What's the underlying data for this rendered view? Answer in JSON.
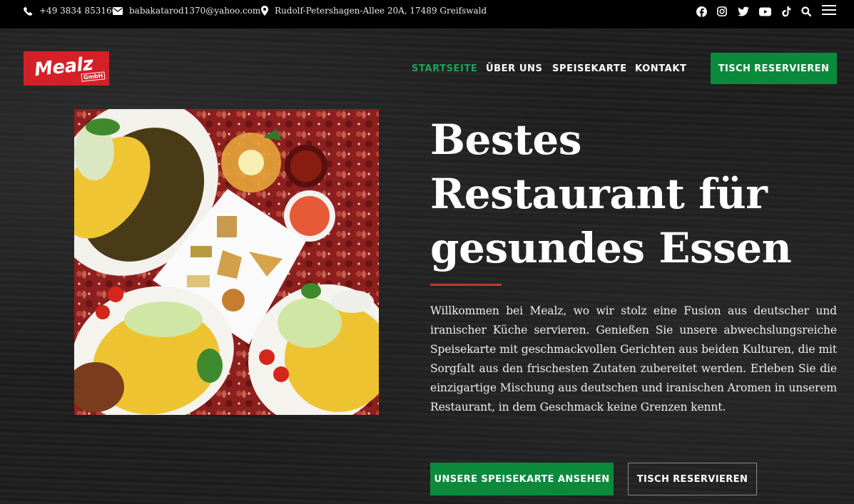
{
  "topbar": {
    "phone": "+49 3834 853160",
    "email": "babakatarod1370@yahoo.com",
    "address": "Rudolf-Petershagen-Allee 20A, 17489 Greifswald",
    "social_icons": [
      "facebook-icon",
      "instagram-icon",
      "twitter-icon",
      "youtube-icon",
      "tiktok-icon",
      "search-icon",
      "menu-icon"
    ]
  },
  "logo": {
    "name": "Mealz",
    "suffix": "GmbH"
  },
  "nav": {
    "items": [
      {
        "label": "STARTSEITE",
        "active": true
      },
      {
        "label": "ÜBER UNS",
        "active": false
      },
      {
        "label": "SPEISEKARTE",
        "active": false
      },
      {
        "label": "KONTAKT",
        "active": false
      }
    ],
    "cta": "TISCH RESERVIEREN"
  },
  "hero": {
    "headline": "Bestes Restaurant für gesundes Essen",
    "intro": "Willkommen bei Mealz, wo wir stolz eine Fusion aus deutscher und iranischer Küche servieren. Genießen Sie unsere abwechslungsreiche Speisekarte mit geschmackvollen Gerichten aus beiden Kulturen, die mit Sorgfalt aus den frischesten Zutaten zubereitet werden. Erleben Sie die einzigartige Mischung aus deutschen und iranischen Aromen in unserem Restaurant, in dem Geschmack keine Grenzen kennt.",
    "primary_button": "UNSERE SPEISEKARTE ANSEHEN",
    "secondary_button": "TISCH RESERVIEREN"
  },
  "colors": {
    "accent_green": "#0b8a3c",
    "active_nav": "#1ea25a",
    "divider_red": "#c0392b",
    "logo_red": "#d42027"
  }
}
